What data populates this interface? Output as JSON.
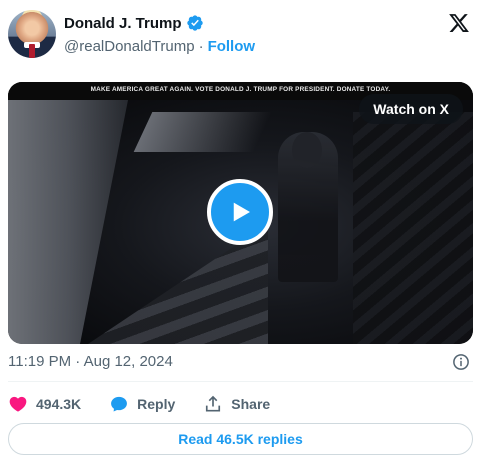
{
  "author": {
    "display_name": "Donald J. Trump",
    "handle": "@realDonaldTrump",
    "separator": "·",
    "follow_label": "Follow"
  },
  "video": {
    "banner_text": "MAKE AMERICA GREAT AGAIN. VOTE DONALD J. TRUMP FOR PRESIDENT. DONATE TODAY.",
    "watch_label": "Watch on X"
  },
  "timestamp": "11:19 PM · Aug 12, 2024",
  "actions": {
    "like_count": "494.3K",
    "reply_label": "Reply",
    "share_label": "Share"
  },
  "read_replies_label": "Read 46.5K replies",
  "colors": {
    "accent": "#1d9bf0",
    "like": "#f91880",
    "muted": "#536471",
    "text": "#0f1419"
  },
  "icons": [
    "verified-badge-icon",
    "x-logo-icon",
    "play-icon",
    "info-icon",
    "heart-icon",
    "reply-bubble-icon",
    "share-icon"
  ]
}
